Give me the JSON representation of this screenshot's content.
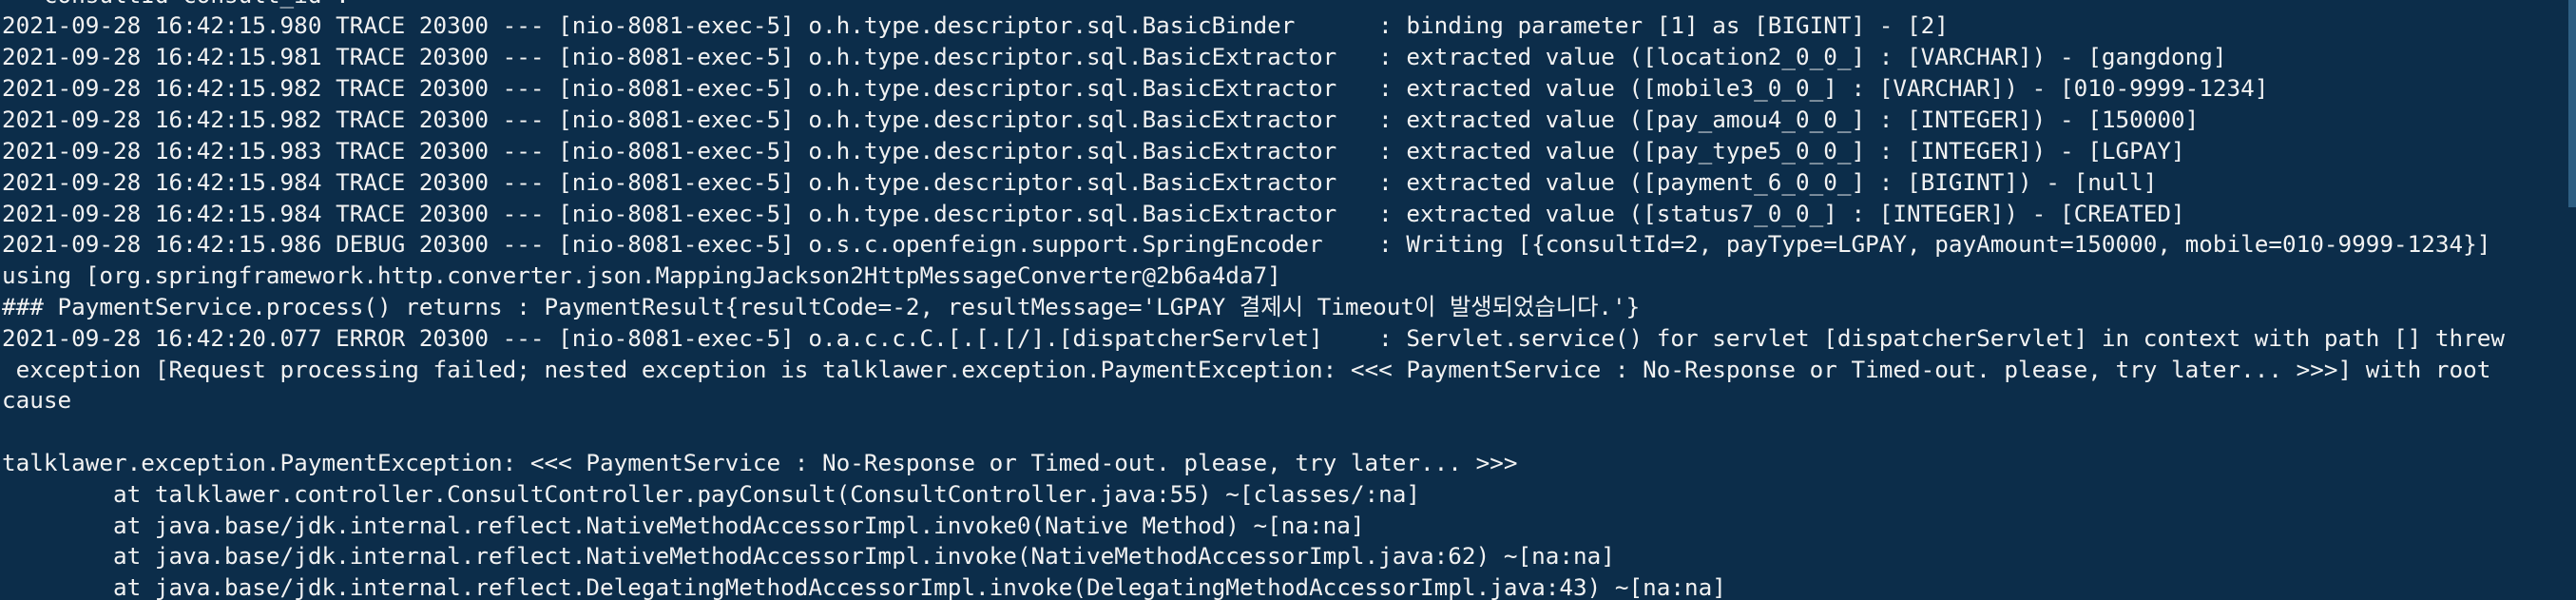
{
  "terminal": {
    "colors": {
      "background": "#0c2d4a",
      "text": "#f2f2f2"
    },
    "lines": [
      "   consultId consult_id .",
      "2021-09-28 16:42:15.980 TRACE 20300 --- [nio-8081-exec-5] o.h.type.descriptor.sql.BasicBinder      : binding parameter [1] as [BIGINT] - [2]",
      "2021-09-28 16:42:15.981 TRACE 20300 --- [nio-8081-exec-5] o.h.type.descriptor.sql.BasicExtractor   : extracted value ([location2_0_0_] : [VARCHAR]) - [gangdong]",
      "2021-09-28 16:42:15.982 TRACE 20300 --- [nio-8081-exec-5] o.h.type.descriptor.sql.BasicExtractor   : extracted value ([mobile3_0_0_] : [VARCHAR]) - [010-9999-1234]",
      "2021-09-28 16:42:15.982 TRACE 20300 --- [nio-8081-exec-5] o.h.type.descriptor.sql.BasicExtractor   : extracted value ([pay_amou4_0_0_] : [INTEGER]) - [150000]",
      "2021-09-28 16:42:15.983 TRACE 20300 --- [nio-8081-exec-5] o.h.type.descriptor.sql.BasicExtractor   : extracted value ([pay_type5_0_0_] : [INTEGER]) - [LGPAY]",
      "2021-09-28 16:42:15.984 TRACE 20300 --- [nio-8081-exec-5] o.h.type.descriptor.sql.BasicExtractor   : extracted value ([payment_6_0_0_] : [BIGINT]) - [null]",
      "2021-09-28 16:42:15.984 TRACE 20300 --- [nio-8081-exec-5] o.h.type.descriptor.sql.BasicExtractor   : extracted value ([status7_0_0_] : [INTEGER]) - [CREATED]",
      "2021-09-28 16:42:15.986 DEBUG 20300 --- [nio-8081-exec-5] o.s.c.openfeign.support.SpringEncoder    : Writing [{consultId=2, payType=LGPAY, payAmount=150000, mobile=010-9999-1234}]",
      "using [org.springframework.http.converter.json.MappingJackson2HttpMessageConverter@2b6a4da7]",
      "### PaymentService.process() returns : PaymentResult{resultCode=-2, resultMessage='LGPAY 결제시 Timeout이 발생되었습니다.'}",
      "2021-09-28 16:42:20.077 ERROR 20300 --- [nio-8081-exec-5] o.a.c.c.C.[.[.[/].[dispatcherServlet]    : Servlet.service() for servlet [dispatcherServlet] in context with path [] threw",
      " exception [Request processing failed; nested exception is talklawer.exception.PaymentException: <<< PaymentService : No-Response or Timed-out. please, try later... >>>] with root",
      "cause",
      "",
      "talklawer.exception.PaymentException: <<< PaymentService : No-Response or Timed-out. please, try later... >>>",
      "        at talklawer.controller.ConsultController.payConsult(ConsultController.java:55) ~[classes/:na]",
      "        at java.base/jdk.internal.reflect.NativeMethodAccessorImpl.invoke0(Native Method) ~[na:na]",
      "        at java.base/jdk.internal.reflect.NativeMethodAccessorImpl.invoke(NativeMethodAccessorImpl.java:62) ~[na:na]",
      "        at java.base/jdk.internal.reflect.DelegatingMethodAccessorImpl.invoke(DelegatingMethodAccessorImpl.java:43) ~[na:na]"
    ]
  }
}
